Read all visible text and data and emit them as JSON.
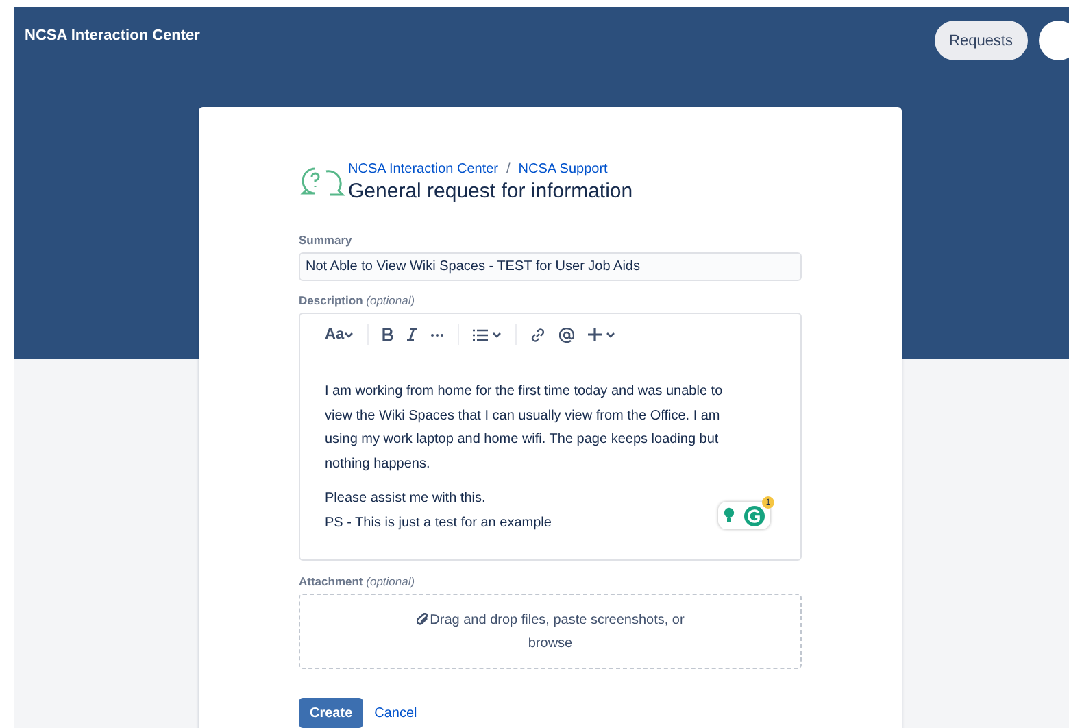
{
  "header": {
    "title": "NCSA Interaction Center",
    "requests_button": "Requests"
  },
  "breadcrumb": [
    "NCSA Interaction Center",
    "NCSA Support"
  ],
  "breadcrumb_separator": "/",
  "title": "General request for information",
  "summary": {
    "label": "Summary",
    "value": "Not Able to View Wiki Spaces - TEST for User Job Aids"
  },
  "description": {
    "label": "Description",
    "optional": "(optional)",
    "toolbar_text_style": "Aa",
    "paragraphs": [
      "I am working from home for the first time today and was unable to view the Wiki Spaces that I can usually view from the Office. I am using my work laptop and home wifi. The page keeps loading but nothing happens.",
      "Please assist me with this.",
      "PS - This is just a test for an example"
    ],
    "grammarly_count": "1"
  },
  "attachment": {
    "label": "Attachment",
    "optional": "(optional)",
    "prompt": "Drag and drop files, paste screenshots, or",
    "browse": "browse"
  },
  "buttons": {
    "create": "Create",
    "cancel": "Cancel"
  }
}
